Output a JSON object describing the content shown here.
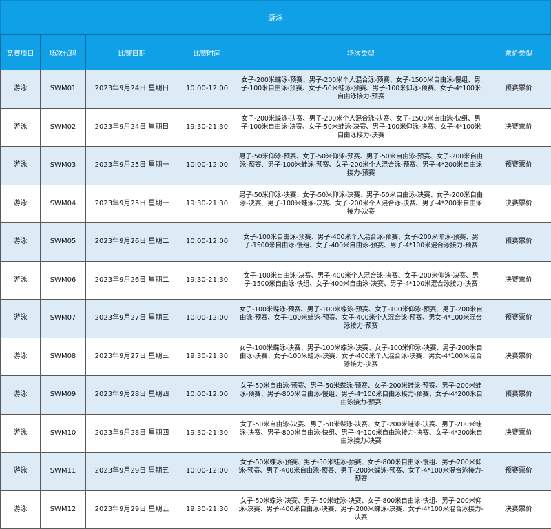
{
  "title": "游泳",
  "headers": [
    "竞赛项目",
    "场次代码",
    "比赛日期",
    "比赛时间",
    "场次类型",
    "票价类型"
  ],
  "rows": [
    {
      "sport": "游泳",
      "code": "SWM01",
      "date": "2023年9月24日 星期日",
      "time": "10:00-12:00",
      "types": "女子-200米蝶泳-预赛、男子-200米个人混合泳-预赛、女子-1500米自由泳-慢组、男子-100米自由泳-预赛、女子-50米蛙泳-预赛、男子-100米仰泳-预赛、女子-4*100米自由泳接力-预赛",
      "ticket": "预赛票价"
    },
    {
      "sport": "游泳",
      "code": "SWM02",
      "date": "2023年9月24日 星期日",
      "time": "19:30-21:30",
      "types": "女子-200米蝶泳-决赛、男子-200米个人混合泳-决赛、女子-1500米自由泳-快组、男子-100米自由泳-决赛、女子-50米蛙泳-决赛、男子-100米仰泳-决赛、女子-4*100米自由泳接力-决赛",
      "ticket": "决赛票价"
    },
    {
      "sport": "游泳",
      "code": "SWM03",
      "date": "2023年9月25日 星期一",
      "time": "10:00-12:00",
      "types": "男子-50米仰泳-预赛、女子-50米仰泳-预赛、男子-50米自由泳-预赛、女子-200米自由泳-预赛、男子-100米蛙泳-预赛、女子-200米个人混合泳-预赛、男子-4*200米自由泳接力-预赛",
      "ticket": "预赛票价"
    },
    {
      "sport": "游泳",
      "code": "SWM04",
      "date": "2023年9月25日 星期一",
      "time": "19:30-21:30",
      "types": "男子-50米仰泳-决赛、女子-50米仰泳-决赛、男子-50米自由泳-决赛、女子-200米自由泳-决赛、男子-100米蛙泳-决赛、女子-200米个人混合泳-决赛、男子-4*200米自由泳接力-决赛",
      "ticket": "决赛票价"
    },
    {
      "sport": "游泳",
      "code": "SWM05",
      "date": "2023年9月26日 星期二",
      "time": "10:00-12:00",
      "types": "女子-100米自由泳-预赛、男子-400米个人混合泳-预赛、女子-200米仰泳-预赛、男子-1500米自由泳-慢组、女子-400米自由泳-预赛、男子-4*100米混合泳接力-预赛",
      "ticket": "预赛票价"
    },
    {
      "sport": "游泳",
      "code": "SWM06",
      "date": "2023年9月26日 星期二",
      "time": "19:30-21:30",
      "types": "女子-100米自由泳-决赛、男子-400米个人混合泳-决赛、女子-200米仰泳-决赛、男子-1500米自由泳-快组、女子-400米自由泳-决赛、男子-4*100米混合泳接力-决赛",
      "ticket": "决赛票价"
    },
    {
      "sport": "游泳",
      "code": "SWM07",
      "date": "2023年9月27日 星期三",
      "time": "10:00-12:00",
      "types": "女子-100米蝶泳-预赛、男子-100米蝶泳-预赛、女子-100米仰泳-预赛、男子-200米自由泳-预赛、女子-100米蛙泳-预赛、女子-400米个人混合泳-预赛、男女-4*100米混合泳接力-预赛",
      "ticket": "预赛票价"
    },
    {
      "sport": "游泳",
      "code": "SWM08",
      "date": "2023年9月27日 星期三",
      "time": "19:30-21:30",
      "types": "女子-100米蝶泳-决赛、男子-100米蝶泳-决赛、女子-100米仰泳-决赛、男子-200米自由泳-决赛、女子-100米蛙泳-决赛、女子-400米个人混合泳-决赛、男女-4*100米混合泳接力-决赛",
      "ticket": "决赛票价"
    },
    {
      "sport": "游泳",
      "code": "SWM09",
      "date": "2023年9月28日 星期四",
      "time": "10:00-12:00",
      "types": "女子-50米自由泳-预赛、男子-50米蝶泳-预赛、女子-200米蛙泳-预赛、男子-200米蛙泳-预赛、男子-800米自由泳-慢组、男子-4*100米自由泳接力-预赛、女子-4*200米自由泳接力-预赛",
      "ticket": "预赛票价"
    },
    {
      "sport": "游泳",
      "code": "SWM10",
      "date": "2023年9月28日 星期四",
      "time": "19:30-21:30",
      "types": "女子-50米自由泳-决赛、男子-50米蝶泳-决赛、女子-200米蛙泳-决赛、男子-200米蛙泳-决赛、男子-800米自由泳-快组、男子-4*100米自由泳接力-决赛、女子-4*200米自由泳接力-决赛",
      "ticket": "决赛票价"
    },
    {
      "sport": "游泳",
      "code": "SWM11",
      "date": "2023年9月29日 星期五",
      "time": "10:00-12:00",
      "types": "女子-50米蝶泳-预赛、男子-50米蛙泳-预赛、女子-800米自由泳-慢组、男子-200米仰泳-预赛、男子-400米自由泳-预赛、男子-200米蝶泳-预赛、女子-4*100米混合泳接力-预赛",
      "ticket": "预赛票价"
    },
    {
      "sport": "游泳",
      "code": "SWM12",
      "date": "2023年9月29日 星期五",
      "time": "19:30-21:30",
      "types": "女子-50米蝶泳-决赛、男子-50米蛙泳-决赛、女子-800米自由泳-快组、男子-200米仰泳-决赛、男子-400米自由泳-决赛、男子-200米蝶泳-决赛、女子-4*100米混合泳接力-决赛",
      "ticket": "决赛票价"
    }
  ],
  "colors": {
    "header_bg": "#0FA0E8",
    "header_text": "#ffffff",
    "row_alt_bg": "#DDEBF7",
    "border": "#5a5a5a"
  }
}
